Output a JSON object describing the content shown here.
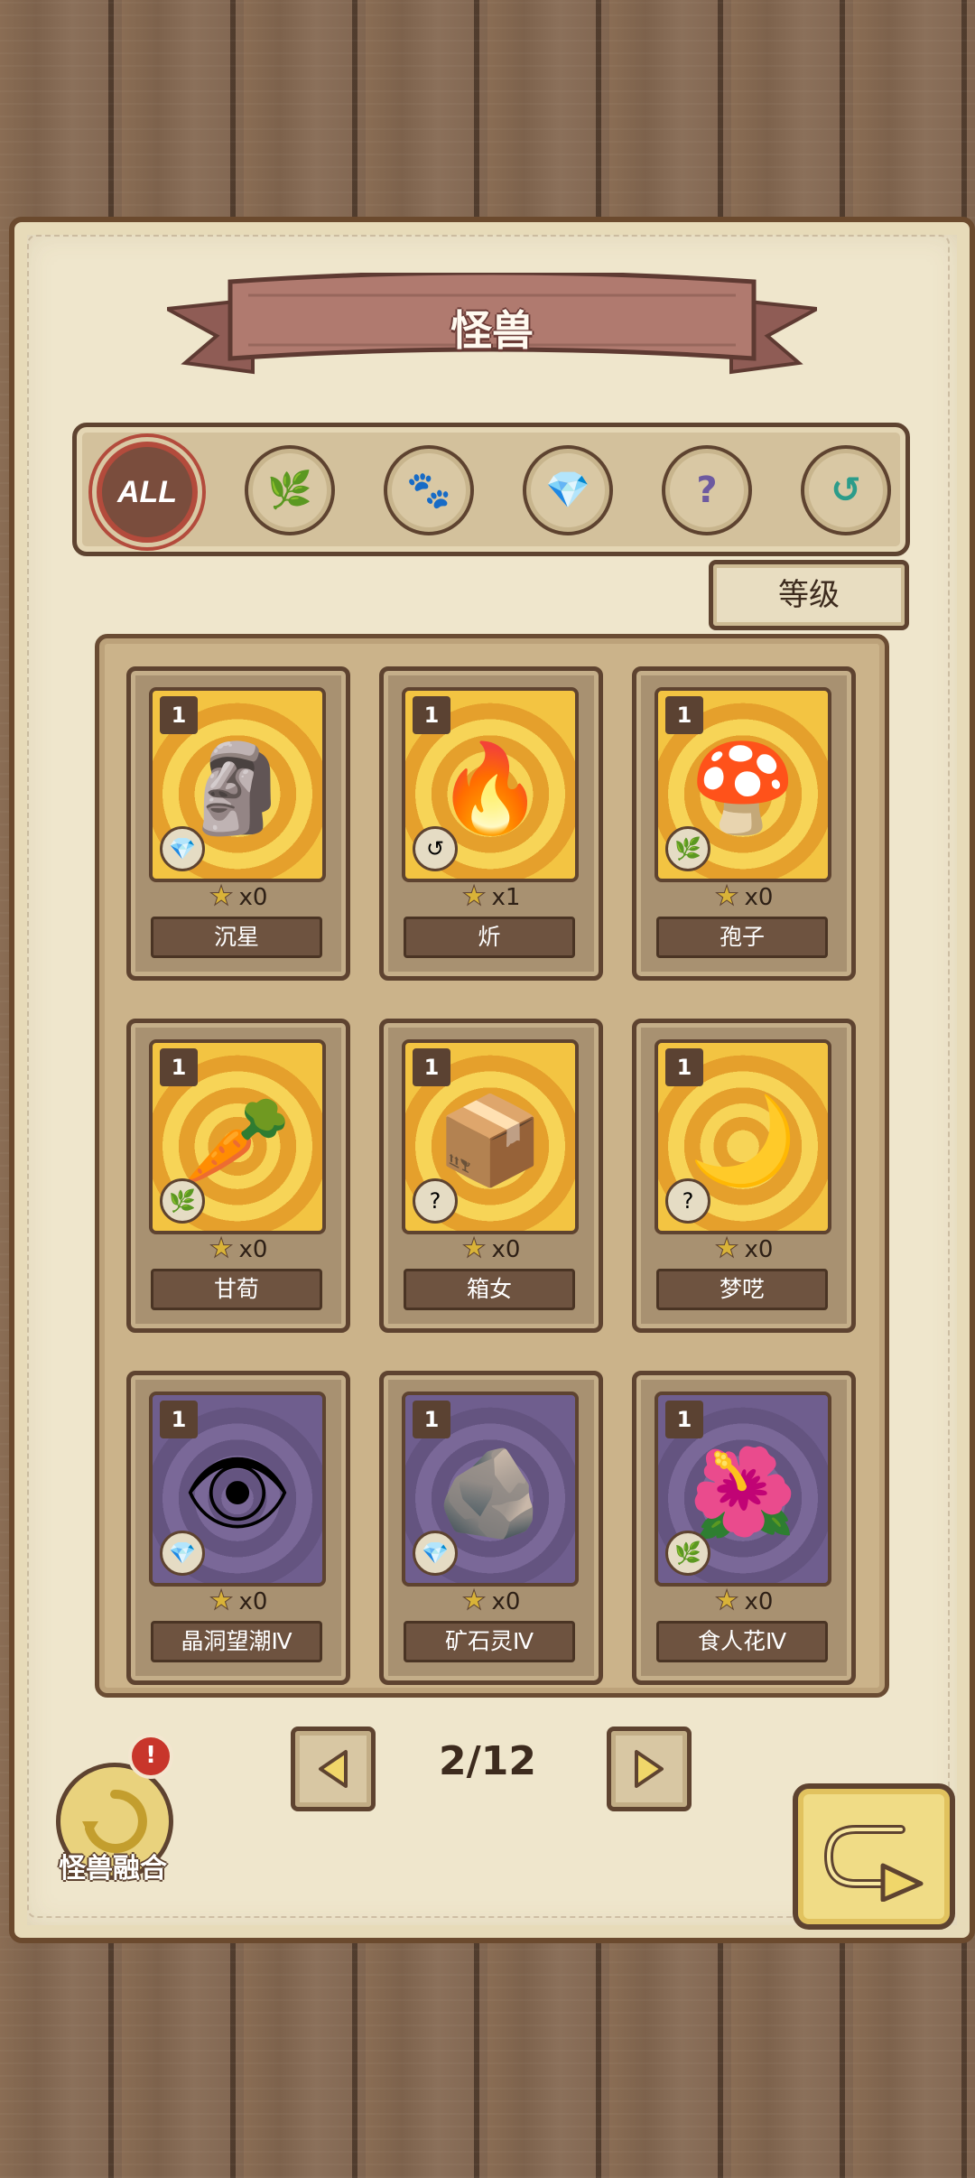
{
  "header": {
    "title": "怪兽"
  },
  "filters": [
    {
      "label": "ALL",
      "icon": "all-icon",
      "selected": true
    },
    {
      "icon": "leaf-icon",
      "glyph": "🌿"
    },
    {
      "icon": "paw-icon",
      "glyph": "🐾"
    },
    {
      "icon": "crystal-icon",
      "glyph": "💎"
    },
    {
      "icon": "question-icon",
      "glyph": "?"
    },
    {
      "icon": "swirl-icon",
      "glyph": "↺"
    }
  ],
  "sort": {
    "label": "等级"
  },
  "cards": [
    {
      "level": "1",
      "name": "沉星",
      "stars": "x0",
      "bg": "gold",
      "type_icon": "crystal-icon",
      "type_glyph": "💎",
      "monster_icon": "rock-golem-icon",
      "monster_glyph": "🗿"
    },
    {
      "level": "1",
      "name": "炘",
      "stars": "x1",
      "bg": "gold",
      "type_icon": "swirl-icon",
      "type_glyph": "↺",
      "monster_icon": "fire-girl-icon",
      "monster_glyph": "🔥"
    },
    {
      "level": "1",
      "name": "孢子",
      "stars": "x0",
      "bg": "gold",
      "type_icon": "leaf-icon",
      "type_glyph": "🌿",
      "monster_icon": "spore-girl-icon",
      "monster_glyph": "🍄"
    },
    {
      "level": "1",
      "name": "甘荀",
      "stars": "x0",
      "bg": "gold",
      "type_icon": "leaf-icon",
      "type_glyph": "🌿",
      "monster_icon": "carrot-girl-icon",
      "monster_glyph": "🥕"
    },
    {
      "level": "1",
      "name": "箱女",
      "stars": "x0",
      "bg": "gold",
      "type_icon": "question-icon",
      "type_glyph": "?",
      "monster_icon": "mimic-girl-icon",
      "monster_glyph": "📦"
    },
    {
      "level": "1",
      "name": "梦呓",
      "stars": "x0",
      "bg": "gold",
      "type_icon": "question-icon",
      "type_glyph": "?",
      "monster_icon": "shadow-girl-icon",
      "monster_glyph": "🌙"
    },
    {
      "level": "1",
      "name": "晶洞望潮Ⅳ",
      "stars": "x0",
      "bg": "purple",
      "type_icon": "crystal-icon",
      "type_glyph": "💎",
      "monster_icon": "crystal-eye-icon",
      "monster_glyph": "👁"
    },
    {
      "level": "1",
      "name": "矿石灵Ⅳ",
      "stars": "x0",
      "bg": "purple",
      "type_icon": "crystal-icon",
      "type_glyph": "💎",
      "monster_icon": "ore-spirit-icon",
      "monster_glyph": "🪨"
    },
    {
      "level": "1",
      "name": "食人花Ⅳ",
      "stars": "x0",
      "bg": "purple",
      "type_icon": "leaf-icon",
      "type_glyph": "🌿",
      "monster_icon": "venus-flytrap-icon",
      "monster_glyph": "🌺"
    }
  ],
  "pagination": {
    "indicator": "2/12"
  },
  "fusion": {
    "label": "怪兽融合",
    "alert": "!"
  },
  "colors": {
    "accent_red": "#b34b3c",
    "gold_card": "#f7d457",
    "purple_card": "#7a6898",
    "wood": "#5e4330"
  }
}
